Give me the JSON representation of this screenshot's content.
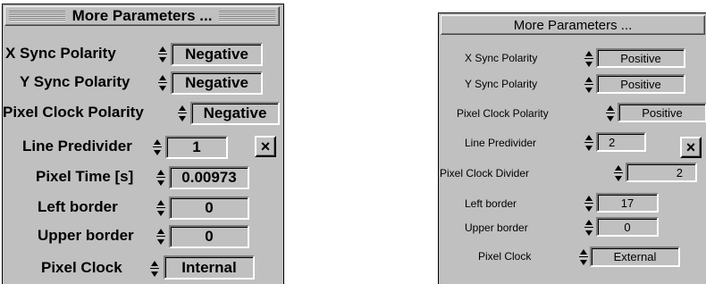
{
  "left": {
    "title": "More Parameters ...",
    "rows": [
      {
        "label": "X Sync Polarity",
        "value": "Negative"
      },
      {
        "label": "Y Sync Polarity",
        "value": "Negative"
      },
      {
        "label": "Pixel Clock Polarity",
        "value": "Negative"
      },
      {
        "label": "Line Predivider",
        "value": "1"
      },
      {
        "label": "Pixel Time [s]",
        "value": "0.00973"
      },
      {
        "label": "Left border",
        "value": "0"
      },
      {
        "label": "Upper border",
        "value": "0"
      },
      {
        "label": "Pixel Clock",
        "value": "Internal"
      }
    ],
    "close_label": "×"
  },
  "right": {
    "title": "More Parameters ...",
    "rows": [
      {
        "label": "X Sync Polarity",
        "value": "Positive"
      },
      {
        "label": "Y Sync Polarity",
        "value": "Positive"
      },
      {
        "label": "Pixel Clock Polarity",
        "value": "Positive"
      },
      {
        "label": "Line Predivider",
        "value": "2"
      },
      {
        "label": "Pixel Clock Divider",
        "value": "2"
      },
      {
        "label": "Left border",
        "value": "17"
      },
      {
        "label": "Upper border",
        "value": "0"
      },
      {
        "label": "Pixel Clock",
        "value": "External"
      }
    ],
    "close_label": "×"
  }
}
